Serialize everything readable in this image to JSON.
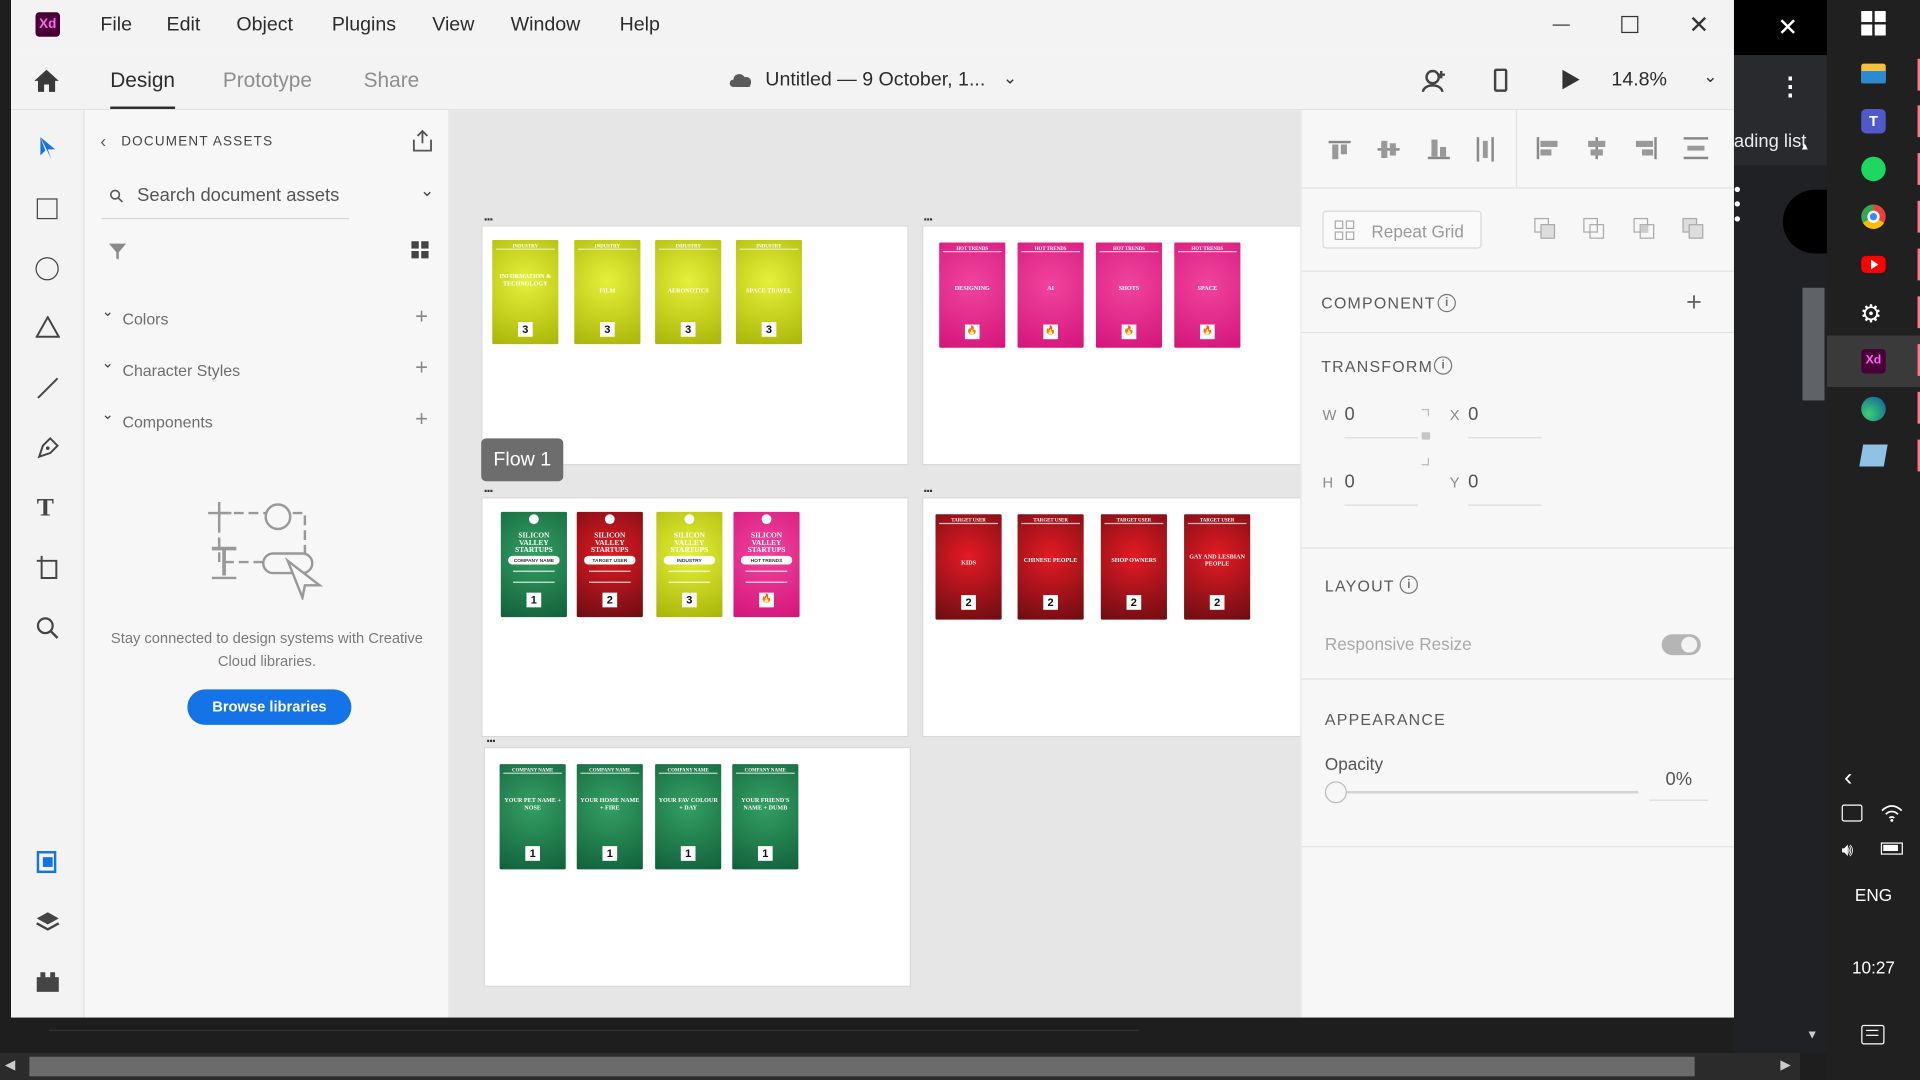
{
  "app": {
    "logo_text": "Xd",
    "menus": [
      "File",
      "Edit",
      "Object",
      "Plugins",
      "View",
      "Window",
      "Help"
    ],
    "tabs": [
      "Design",
      "Prototype",
      "Share"
    ],
    "active_tab": "Design",
    "doc_title": "Untitled — 9 October, 1...",
    "zoom": "14.8%"
  },
  "assets": {
    "header": "DOCUMENT ASSETS",
    "search_placeholder": "Search document assets",
    "sections": [
      "Colors",
      "Character Styles",
      "Components"
    ],
    "empty_text_1": "Stay connected to design systems with Creative",
    "empty_text_2": "Cloud libraries.",
    "browse_button": "Browse libraries"
  },
  "canvas": {
    "flow_label": "Flow 1",
    "artboard1": {
      "cards": [
        {
          "header": "INDUSTRY",
          "label": "INFORMATION & TECHNOLOGY",
          "num": "3"
        },
        {
          "header": "INDUSTRY",
          "label": "FILM",
          "num": "3"
        },
        {
          "header": "INDUSTRY",
          "label": "AERONOTICS",
          "num": "3"
        },
        {
          "header": "INDUSTRY",
          "label": "SPACE TRAVEL",
          "num": "3"
        }
      ]
    },
    "artboard2": {
      "cards": [
        {
          "header": "HOT TRENDS",
          "label": "DESIGNING",
          "num": "🔥"
        },
        {
          "header": "HOT TRENDS",
          "label": "AI",
          "num": "🔥"
        },
        {
          "header": "HOT TRENDS",
          "label": "SHOTS",
          "num": "🔥"
        },
        {
          "header": "HOT TRENDS",
          "label": "SPACE",
          "num": "🔥"
        }
      ]
    },
    "artboard3": {
      "cards": [
        {
          "title": "SILICON VALLEY STARTUPS",
          "pill": "COMPANY NAME",
          "num": "1"
        },
        {
          "title": "SILICON VALLEY STARTUPS",
          "pill": "TARGET USER",
          "num": "2"
        },
        {
          "title": "SILICON VALLEY STARTUPS",
          "pill": "INDUSTRY",
          "num": "3"
        },
        {
          "title": "SILICON VALLEY STARTUPS",
          "pill": "HOT TRENDS",
          "num": "🔥"
        }
      ]
    },
    "artboard4": {
      "cards": [
        {
          "header": "TARGET USER",
          "label": "KIDS",
          "num": "2"
        },
        {
          "header": "TARGET USER",
          "label": "CHINESE PEOPLE",
          "num": "2"
        },
        {
          "header": "TARGET USER",
          "label": "SHOP OWNERS",
          "num": "2"
        },
        {
          "header": "TARGET USER",
          "label": "GAY AND LESBIAN PEOPLE",
          "num": "2"
        }
      ]
    },
    "artboard5": {
      "cards": [
        {
          "header": "COMPANY NAME",
          "label": "YOUR PET NAME + NOSE",
          "num": "1"
        },
        {
          "header": "COMPANY NAME",
          "label": "YOUR HOME NAME + FIRE",
          "num": "1"
        },
        {
          "header": "COMPANY NAME",
          "label": "YOUR FAV COLOUR + DAY",
          "num": "1"
        },
        {
          "header": "COMPANY NAME",
          "label": "YOUR FRIEND'S NAME + DUMB",
          "num": "1"
        }
      ]
    }
  },
  "props": {
    "repeat_grid": "Repeat Grid",
    "component": "COMPONENT",
    "transform": "TRANSFORM",
    "w_label": "W",
    "w_value": "0",
    "x_label": "X",
    "x_value": "0",
    "h_label": "H",
    "h_value": "0",
    "y_label": "Y",
    "y_value": "0",
    "layout": "LAYOUT",
    "responsive": "Responsive Resize",
    "appearance": "APPEARANCE",
    "opacity_label": "Opacity",
    "opacity_value": "0%"
  },
  "background": {
    "reading_list": "ading list"
  },
  "taskbar": {
    "lang": "ENG",
    "time": "10:27"
  },
  "colors": {
    "accent": "#1473e6",
    "xd_brand": "#470137",
    "xd_pink": "#ff61f6"
  }
}
